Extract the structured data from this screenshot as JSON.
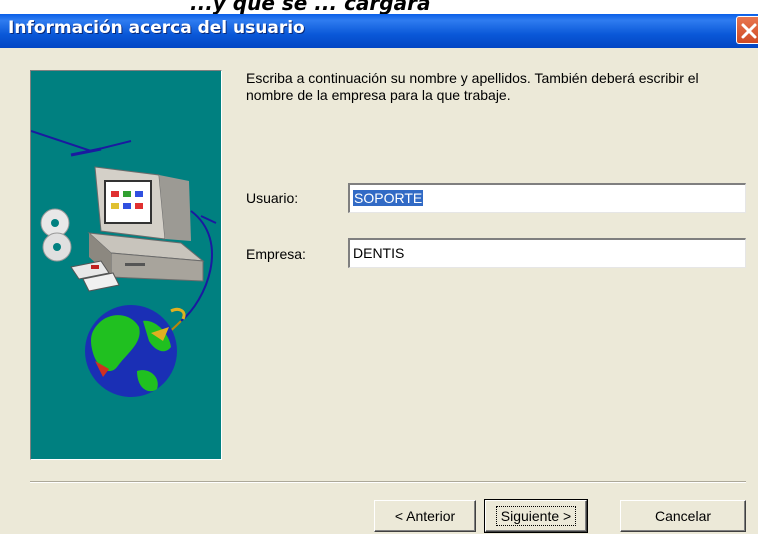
{
  "banner": {
    "partial_text": "...y que se ... cargará"
  },
  "window": {
    "title": "Información acerca del usuario",
    "close_icon": "close-icon"
  },
  "art": {
    "icon": "computer-globe-illustration"
  },
  "instructions": "Escriba a continuación su nombre y apellidos. También deberá escribir el nombre de la empresa para la que trabaje.",
  "fields": {
    "usuario": {
      "label": "Usuario:",
      "value": "SOPORTE",
      "selected": true
    },
    "empresa": {
      "label": "Empresa:",
      "value": "DENTIS"
    }
  },
  "buttons": {
    "back": "< Anterior",
    "next": "Siguiente >",
    "cancel": "Cancelar"
  },
  "colors": {
    "title_bar": "#0a58d8",
    "panel": "#008080",
    "dialog_bg": "#ece9d8",
    "selection": "#316ac5"
  }
}
